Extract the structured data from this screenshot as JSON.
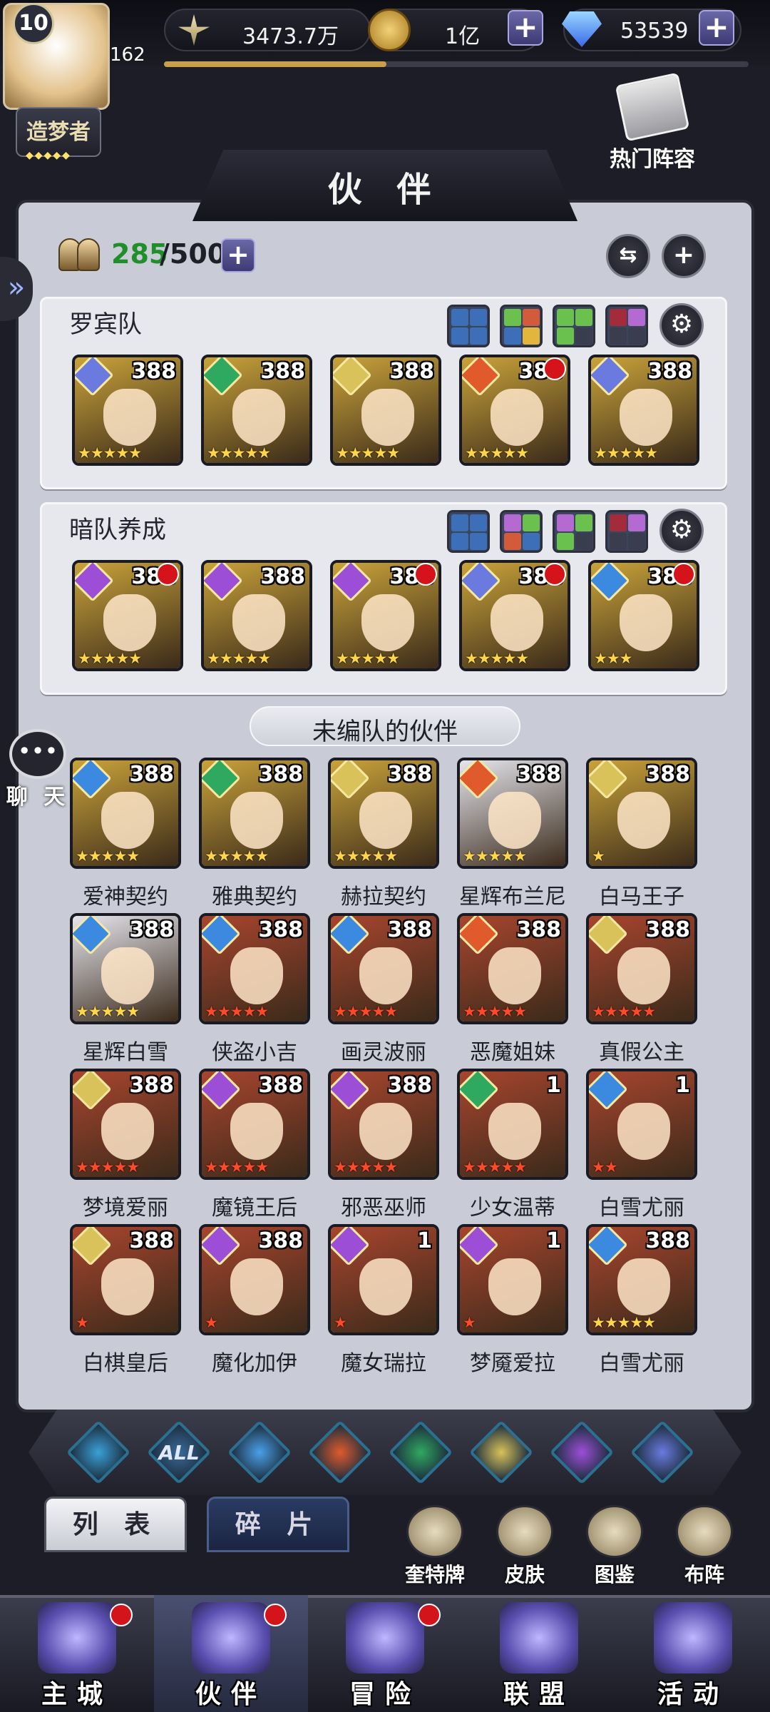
{
  "topbar": {
    "power": "3473.7万",
    "gold": "1亿",
    "diamonds": "53539",
    "player_level": "10",
    "player_level_progress": "162",
    "player_title": "造梦者"
  },
  "hot_lineup_label": "热门阵容",
  "panel_title": "伙 伴",
  "partner_count": {
    "current": "285",
    "max": "/500"
  },
  "teams": [
    {
      "name": "罗宾队",
      "formation_colors": [
        [
          "#3d6fb8",
          "#3d6fb8",
          "#3d6fb8",
          "#3d6fb8"
        ],
        [
          "#6ac14d",
          "#d35a3a",
          "#3d6fb8",
          "#e2b63c"
        ],
        [
          "#6ac14d",
          "#6ac14d",
          "#6ac14d",
          "#3a3d4e"
        ],
        [
          "#a22c3a",
          "#b46ad0",
          "#3a3d4e",
          "#3a3d4e"
        ]
      ],
      "heroes": [
        {
          "level": "388",
          "element": "#6a7adf",
          "bg": "#c9a33a",
          "stars": 5,
          "star_color": "#ffd54a",
          "dot": false
        },
        {
          "level": "388",
          "element": "#2fa860",
          "bg": "#c9a33a",
          "stars": 5,
          "star_color": "#ffd54a",
          "dot": false
        },
        {
          "level": "388",
          "element": "#d9c25a",
          "bg": "#c9a33a",
          "stars": 5,
          "star_color": "#ffd54a",
          "dot": false
        },
        {
          "level": "388",
          "element": "#e05a2c",
          "bg": "#c9a33a",
          "stars": 5,
          "star_color": "#ffd54a",
          "dot": true
        },
        {
          "level": "388",
          "element": "#6a7adf",
          "bg": "#c9a33a",
          "stars": 5,
          "star_color": "#ffd54a",
          "dot": false
        }
      ]
    },
    {
      "name": "暗队养成",
      "formation_colors": [
        [
          "#3d6fb8",
          "#3d6fb8",
          "#3d6fb8",
          "#3d6fb8"
        ],
        [
          "#b46ad0",
          "#6ac14d",
          "#d35a3a",
          "#3d6fb8"
        ],
        [
          "#b46ad0",
          "#6ac14d",
          "#6ac14d",
          "#3a3d4e"
        ],
        [
          "#a22c3a",
          "#b46ad0",
          "#3a3d4e",
          "#3a3d4e"
        ]
      ],
      "heroes": [
        {
          "level": "388",
          "element": "#9c4fd6",
          "bg": "#c9a33a",
          "stars": 5,
          "star_color": "#ffd54a",
          "dot": true
        },
        {
          "level": "388",
          "element": "#9c4fd6",
          "bg": "#c9a33a",
          "stars": 5,
          "star_color": "#ffd54a",
          "dot": false
        },
        {
          "level": "388",
          "element": "#9c4fd6",
          "bg": "#c9a33a",
          "stars": 5,
          "star_color": "#ffd54a",
          "dot": true
        },
        {
          "level": "388",
          "element": "#6a7adf",
          "bg": "#c9a33a",
          "stars": 5,
          "star_color": "#ffd54a",
          "dot": true
        },
        {
          "level": "388",
          "element": "#3b8ae0",
          "bg": "#c9a33a",
          "stars": 3,
          "star_color": "#ffd54a",
          "dot": true
        }
      ]
    }
  ],
  "unassigned_label": "未编队的伙伴",
  "heroes": [
    {
      "name": "爱神契约",
      "level": "388",
      "element": "#3b8ae0",
      "bg": "#c9a33a",
      "stars": 5,
      "star_color": "#ffd54a"
    },
    {
      "name": "雅典契约",
      "level": "388",
      "element": "#2fa860",
      "bg": "#c9a33a",
      "stars": 5,
      "star_color": "#ffd54a"
    },
    {
      "name": "赫拉契约",
      "level": "388",
      "element": "#d9c25a",
      "bg": "#c9a33a",
      "stars": 5,
      "star_color": "#ffd54a"
    },
    {
      "name": "星辉布兰尼",
      "level": "388",
      "element": "#e05a2c",
      "bg": "#e6e6ee",
      "stars": 5,
      "star_color": "#ffd54a"
    },
    {
      "name": "白马王子",
      "level": "388",
      "element": "#d9c25a",
      "bg": "#c9a33a",
      "stars": 1,
      "star_color": "#ffd54a"
    },
    {
      "name": "星辉白雪",
      "level": "388",
      "element": "#3b8ae0",
      "bg": "#e6e6ee",
      "stars": 5,
      "star_color": "#ffd54a"
    },
    {
      "name": "侠盗小吉",
      "level": "388",
      "element": "#3b8ae0",
      "bg": "#a8452e",
      "stars": 5,
      "star_color": "#ff4a2a"
    },
    {
      "name": "画灵波丽",
      "level": "388",
      "element": "#3b8ae0",
      "bg": "#a8452e",
      "stars": 5,
      "star_color": "#ff4a2a"
    },
    {
      "name": "恶魔姐妹",
      "level": "388",
      "element": "#e05a2c",
      "bg": "#a8452e",
      "stars": 5,
      "star_color": "#ff4a2a"
    },
    {
      "name": "真假公主",
      "level": "388",
      "element": "#d9c25a",
      "bg": "#a8452e",
      "stars": 5,
      "star_color": "#ff4a2a"
    },
    {
      "name": "梦境爱丽",
      "level": "388",
      "element": "#d9c25a",
      "bg": "#a8452e",
      "stars": 5,
      "star_color": "#ff4a2a"
    },
    {
      "name": "魔镜王后",
      "level": "388",
      "element": "#9c4fd6",
      "bg": "#a8452e",
      "stars": 5,
      "star_color": "#ff4a2a"
    },
    {
      "name": "邪恶巫师",
      "level": "388",
      "element": "#9c4fd6",
      "bg": "#a8452e",
      "stars": 5,
      "star_color": "#ff4a2a"
    },
    {
      "name": "少女温蒂",
      "level": "1",
      "element": "#2fa860",
      "bg": "#a8452e",
      "stars": 5,
      "star_color": "#ff4a2a"
    },
    {
      "name": "白雪尤丽",
      "level": "1",
      "element": "#3b8ae0",
      "bg": "#a8452e",
      "stars": 2,
      "star_color": "#ff4a2a"
    },
    {
      "name": "白棋皇后",
      "level": "388",
      "element": "#d9c25a",
      "bg": "#a8452e",
      "stars": 1,
      "star_color": "#ff4a2a"
    },
    {
      "name": "魔化加伊",
      "level": "388",
      "element": "#9c4fd6",
      "bg": "#a8452e",
      "stars": 1,
      "star_color": "#ff4a2a"
    },
    {
      "name": "魔女瑞拉",
      "level": "1",
      "element": "#9c4fd6",
      "bg": "#a8452e",
      "stars": 1,
      "star_color": "#ff4a2a"
    },
    {
      "name": "梦魇爱拉",
      "level": "1",
      "element": "#9c4fd6",
      "bg": "#a8452e",
      "stars": 1,
      "star_color": "#ff4a2a"
    },
    {
      "name": "白雪尤丽",
      "level": "388",
      "element": "#3b8ae0",
      "bg": "#a8452e",
      "stars": 5,
      "star_color": "#ffd54a"
    }
  ],
  "chat_label": "聊 天",
  "filters": [
    {
      "id": "ocean",
      "color": "#3aa0d8",
      "label": ""
    },
    {
      "id": "all",
      "color": "#3a6a9a",
      "label": "ALL"
    },
    {
      "id": "water",
      "color": "#4aa0e8",
      "label": ""
    },
    {
      "id": "fire",
      "color": "#e05a2c",
      "label": ""
    },
    {
      "id": "wind",
      "color": "#2fa860",
      "label": ""
    },
    {
      "id": "light",
      "color": "#d9c25a",
      "label": ""
    },
    {
      "id": "dark",
      "color": "#9c4fd6",
      "label": ""
    },
    {
      "id": "cosmic",
      "color": "#6a7adf",
      "label": ""
    }
  ],
  "tabs": {
    "list": "列 表",
    "shards": "碎 片"
  },
  "utilities": [
    {
      "label": "奎特牌"
    },
    {
      "label": "皮肤"
    },
    {
      "label": "图鉴"
    },
    {
      "label": "布阵"
    }
  ],
  "nav": [
    {
      "label": "主城",
      "dot": true,
      "active": false
    },
    {
      "label": "伙伴",
      "dot": true,
      "active": true
    },
    {
      "label": "冒险",
      "dot": true,
      "active": false
    },
    {
      "label": "联盟",
      "dot": false,
      "active": false
    },
    {
      "label": "活动",
      "dot": false,
      "active": false
    }
  ]
}
